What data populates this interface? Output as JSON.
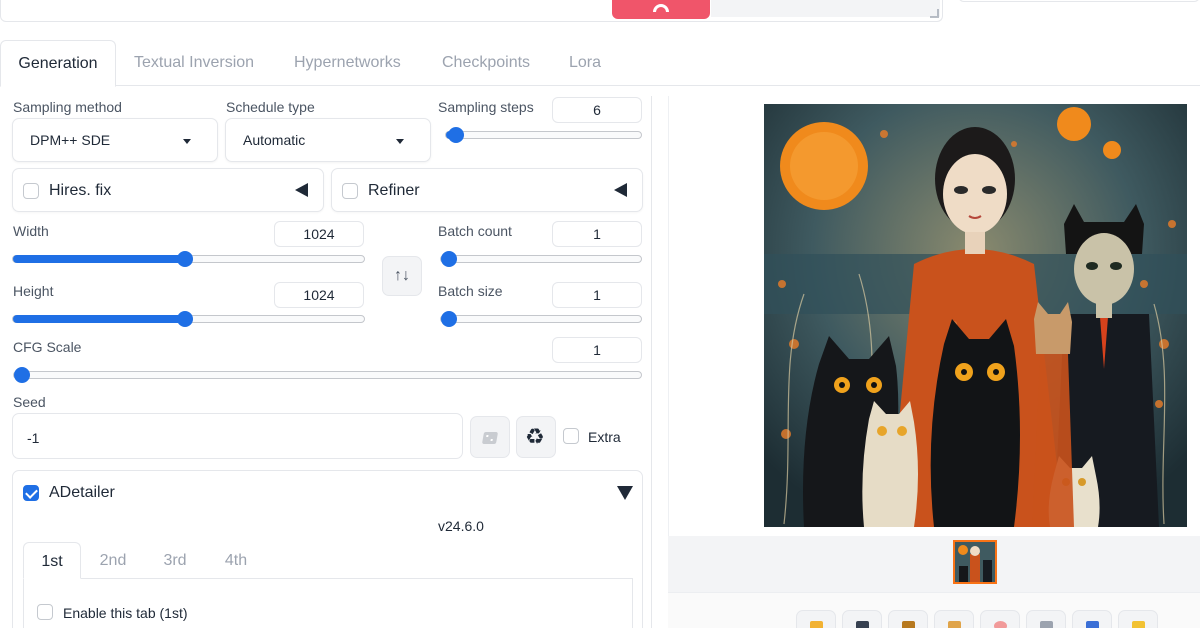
{
  "tabs": [
    "Generation",
    "Textual Inversion",
    "Hypernetworks",
    "Checkpoints",
    "Lora"
  ],
  "sampling": {
    "method_label": "Sampling method",
    "method_value": "DPM++ SDE",
    "schedule_label": "Schedule type",
    "schedule_value": "Automatic",
    "steps_label": "Sampling steps",
    "steps_value": "6",
    "steps_fraction": 0.05
  },
  "accordions": {
    "hires_label": "Hires. fix",
    "refiner_label": "Refiner"
  },
  "dimensions": {
    "width_label": "Width",
    "width_value": "1024",
    "width_fraction": 0.49,
    "height_label": "Height",
    "height_value": "1024",
    "height_fraction": 0.49,
    "swap_icon": "↑↓"
  },
  "batch": {
    "count_label": "Batch count",
    "count_value": "1",
    "count_fraction": 0.0,
    "size_label": "Batch size",
    "size_value": "1",
    "size_fraction": 0.0
  },
  "cfg": {
    "label": "CFG Scale",
    "value": "1",
    "fraction": 0.0
  },
  "seed": {
    "label": "Seed",
    "value": "-1",
    "extra_label": "Extra",
    "recycle_icon": "♻"
  },
  "adetailer": {
    "label": "ADetailer",
    "version": "v24.6.0",
    "tabs": [
      "1st",
      "2nd",
      "3rd",
      "4th"
    ],
    "enable_label": "Enable this tab (1st)"
  },
  "colors": {
    "accent": "#1f6fe5",
    "interrupt": "#f0556a",
    "thumbnail_border": "#f97316"
  },
  "icons": {
    "interrupt": "stop-icon",
    "dice": "dice-icon",
    "recycle": "recycle-icon",
    "collapse": "triangle-left-icon",
    "expand": "triangle-down-icon"
  }
}
